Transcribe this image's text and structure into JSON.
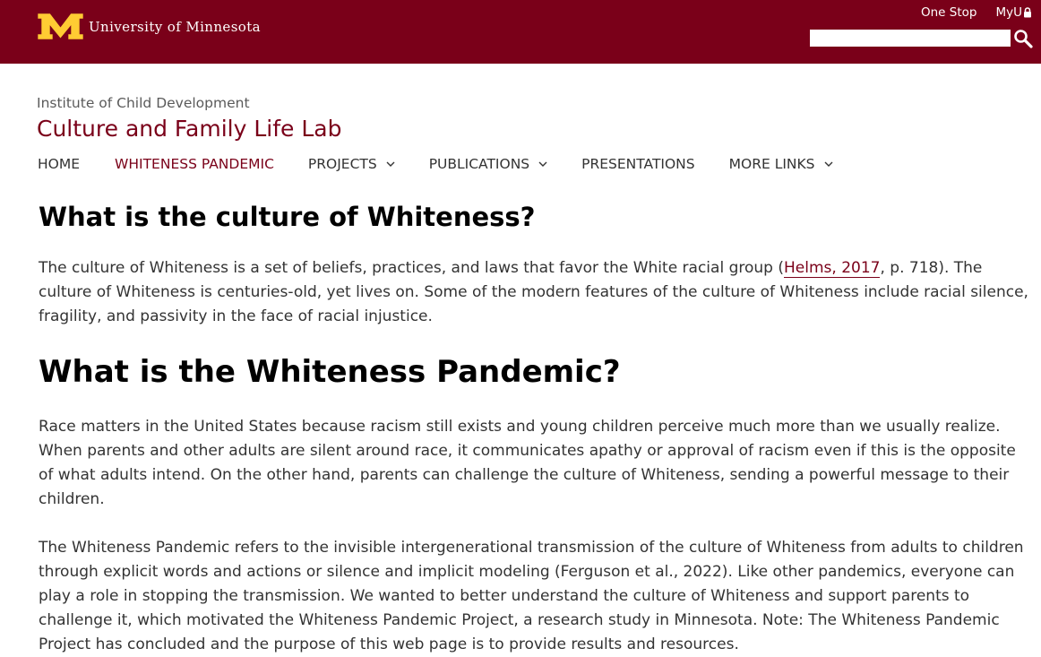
{
  "header": {
    "logo_text": "University of Minnesota",
    "links": [
      {
        "label": "One Stop"
      },
      {
        "label": "MyU"
      }
    ],
    "search_placeholder": "",
    "colors": {
      "maroon": "#7a0019",
      "gold": "#ffcc33"
    }
  },
  "site": {
    "parent_unit": "Institute of Child Development",
    "title": "Culture and Family Life Lab"
  },
  "nav": [
    {
      "label": "HOME",
      "dropdown": false,
      "active": false
    },
    {
      "label": "WHITENESS PANDEMIC",
      "dropdown": false,
      "active": true
    },
    {
      "label": "PROJECTS",
      "dropdown": true,
      "active": false
    },
    {
      "label": "PUBLICATIONS",
      "dropdown": true,
      "active": false
    },
    {
      "label": "PRESENTATIONS",
      "dropdown": false,
      "active": false
    },
    {
      "label": "MORE LINKS",
      "dropdown": true,
      "active": false
    }
  ],
  "content": {
    "h1_culture": "What is the culture of Whiteness?",
    "p1": {
      "before": "The culture of Whiteness is a set of beliefs, practices, and laws that favor the White racial group (",
      "link": "Helms, 2017",
      "after": ", p. 718). The culture of Whiteness is centuries-old, yet lives on. Some of the modern features of the culture of Whiteness include racial silence, fragility, and passivity in the face of racial injustice."
    },
    "h1_pandemic": "What is the Whiteness Pandemic?",
    "p2": "Race matters in the United States because racism still exists and young children perceive much more than we usually realize. When parents and other adults are silent around race, it communicates apathy or approval of racism even if this is the opposite of what adults intend. On the other hand, parents can challenge the culture of Whiteness, sending a powerful message to their children.",
    "p3": "The Whiteness Pandemic refers to the invisible intergenerational transmission of the culture of Whiteness from adults to children through explicit words and actions or silence and implicit modeling (Ferguson et al., 2022). Like other pandemics, everyone can play a role in stopping the transmission. We wanted to better understand the culture of Whiteness and support parents to challenge it, which motivated the Whiteness Pandemic Project, a research study in Minnesota. Note: The Whiteness Pandemic Project has concluded and the purpose of this web page is to provide results and resources."
  }
}
